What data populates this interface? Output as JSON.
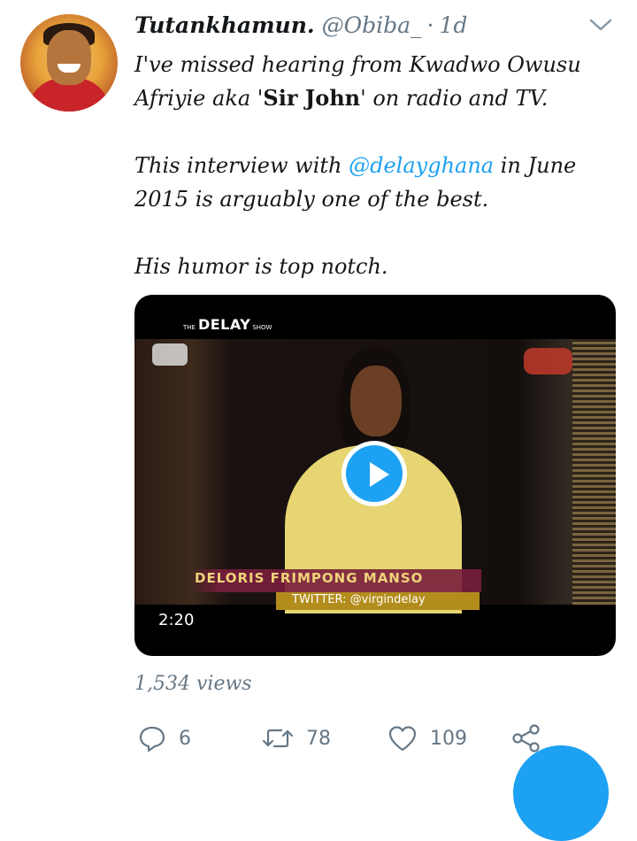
{
  "tweet": {
    "author_name": "Tutankhamun.",
    "author_handle": "@Obiba_",
    "separator": "·",
    "time": "1d",
    "text": {
      "p1_before": "I've missed hearing from Kwadwo Owusu Afriyie aka '",
      "p1_bold": "Sir John",
      "p1_after": "' on radio and TV.",
      "p2_before": "This interview with ",
      "p2_mention": "@delayghana",
      "p2_after": " in June 2015 is arguably one of the best.",
      "p3": "His humor is top notch."
    }
  },
  "video": {
    "show_logo_pre": "THE",
    "show_logo_main": "DELAY",
    "show_logo_post": "SHOW",
    "lower_third_name": "DELORIS FRIMPONG MANSO",
    "lower_third_sub": "TWITTER: @virgindelay",
    "duration": "2:20"
  },
  "stats": {
    "views": "1,534 views",
    "replies": "6",
    "retweets": "78",
    "likes": "109"
  },
  "icons": {
    "reply": "reply-icon",
    "retweet": "retweet-icon",
    "like": "heart-icon",
    "share": "share-icon",
    "menu": "chevron-down-icon",
    "play": "play-icon"
  },
  "colors": {
    "accent": "#1da1f2",
    "muted": "#657786",
    "text": "#14171a"
  }
}
